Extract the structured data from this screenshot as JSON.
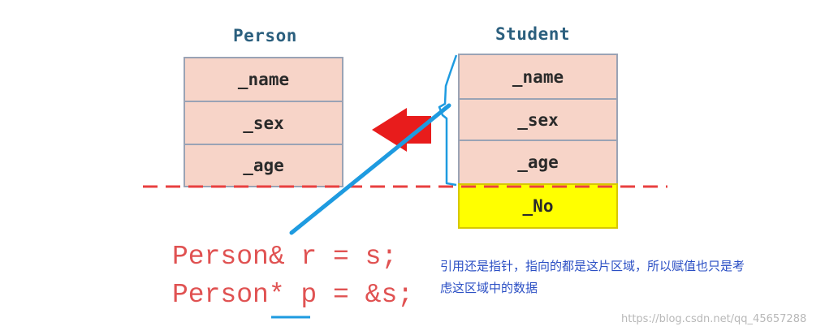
{
  "person": {
    "title": "Person",
    "fields": [
      "_name",
      "_sex",
      "_age"
    ]
  },
  "student": {
    "title": "Student",
    "fields": [
      "_name",
      "_sex",
      "_age"
    ],
    "extra_field": "_No"
  },
  "code": {
    "line1": "Person& r = s;",
    "line2": "Person* p = &s;"
  },
  "note": {
    "line1": "引用还是指针，指向的都是这片区域，所以赋值也只是考",
    "line2": "虑这区域中的数据"
  },
  "watermark": "https://blog.csdn.net/qq_45657288",
  "colors": {
    "field_fill": "#f7d4c8",
    "extra_field_fill": "#ffff00",
    "dashed_line": "#e84040",
    "arrow_red": "#e81c1c",
    "pointer_blue": "#1e9be0",
    "code_red": "#e05252",
    "note_blue": "#2b4fc4"
  }
}
